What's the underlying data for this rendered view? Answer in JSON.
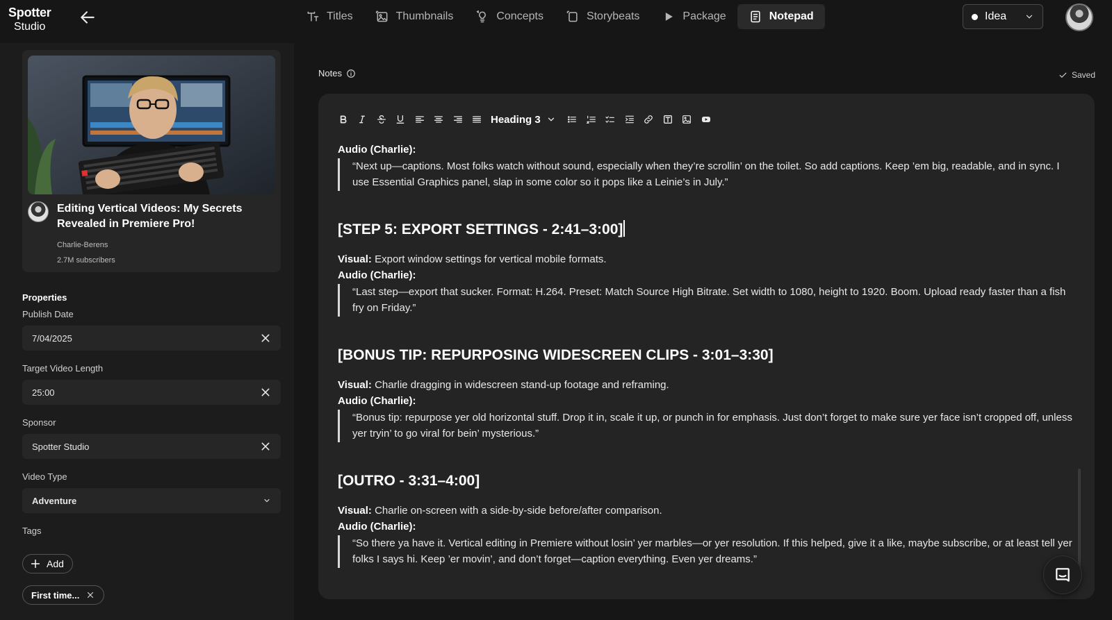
{
  "brand": {
    "line1": "Spotter",
    "line2": "Studio"
  },
  "nav": [
    {
      "label": "Titles",
      "icon": "text-t-icon"
    },
    {
      "label": "Thumbnails",
      "icon": "image-icon"
    },
    {
      "label": "Concepts",
      "icon": "lightbulb-icon"
    },
    {
      "label": "Storybeats",
      "icon": "storyboard-icon"
    },
    {
      "label": "Package",
      "icon": "play-icon"
    },
    {
      "label": "Notepad",
      "icon": "notepad-icon",
      "active": true
    }
  ],
  "status": {
    "label": "Idea"
  },
  "video": {
    "title": "Editing Vertical Videos: My Secrets Revealed in Premiere Pro!",
    "channel": "Charlie-Berens",
    "subscribers": "2.7M subscribers"
  },
  "properties": {
    "heading": "Properties",
    "publish_date": {
      "label": "Publish Date",
      "value": "7/04/2025"
    },
    "target_length": {
      "label": "Target Video Length",
      "value": "25:00"
    },
    "sponsor": {
      "label": "Sponsor",
      "value": "Spotter Studio"
    },
    "video_type": {
      "label": "Video Type",
      "value": "Adventure"
    },
    "tags": {
      "label": "Tags",
      "add_label": "Add",
      "items": [
        "First time..."
      ]
    }
  },
  "notes": {
    "label": "Notes",
    "saved_label": "Saved",
    "heading_select": "Heading 3",
    "blocks": {
      "b1_audio": "Audio (Charlie):",
      "b1_quote": "“Next up—captions. Most folks watch without sound, especially when they’re scrollin’ on the toilet. So add captions. Keep ’em big, readable, and in sync. I use Essential Graphics panel, slap in some color so it pops like a Leinie’s in July.”",
      "h_step5": "[STEP 5: EXPORT SETTINGS - 2:41–3:00]",
      "s5_visual_label": "Visual:",
      "s5_visual": "Export window settings for vertical mobile formats.",
      "s5_audio": "Audio (Charlie):",
      "s5_quote": "“Last step—export that sucker. Format: H.264. Preset: Match Source High Bitrate. Set width to 1080, height to 1920. Boom. Upload ready faster than a fish fry on Friday.”",
      "h_bonus": "[BONUS TIP: REPURPOSING WIDESCREEN CLIPS - 3:01–3:30]",
      "bonus_visual_label": "Visual:",
      "bonus_visual": "Charlie dragging in widescreen stand-up footage and reframing.",
      "bonus_audio": "Audio (Charlie):",
      "bonus_quote": "“Bonus tip: repurpose yer old horizontal stuff. Drop it in, scale it up, or punch in for emphasis. Just don’t forget to make sure yer face isn’t cropped off, unless yer tryin’ to go viral for bein’ mysterious.”",
      "h_outro": "[OUTRO - 3:31–4:00]",
      "outro_visual_label": "Visual:",
      "outro_visual": "Charlie on-screen with a side-by-side before/after comparison.",
      "outro_audio": "Audio (Charlie):",
      "outro_quote": "“So there ya have it. Vertical editing in Premiere without losin’ yer marbles—or yer resolution. If this helped, give it a like, maybe subscribe, or at least tell yer folks I says hi. Keep ’er movin’, and don’t forget—caption everything. Even yer dreams.”"
    }
  }
}
